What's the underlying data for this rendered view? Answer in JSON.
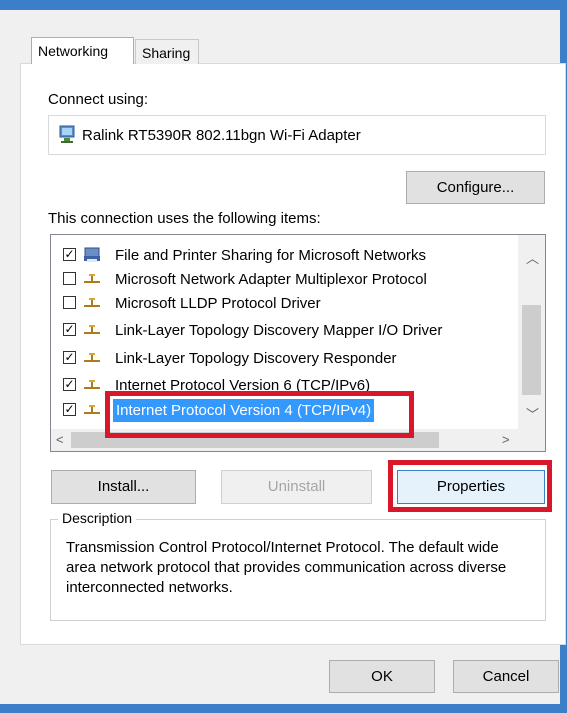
{
  "tabs": [
    {
      "label": "Networking",
      "active": true
    },
    {
      "label": "Sharing",
      "active": false
    }
  ],
  "connect_using_label": "Connect using:",
  "adapter_name": "Ralink RT5390R 802.11bgn Wi-Fi Adapter",
  "configure_button": "Configure...",
  "items_label": "This connection uses the following items:",
  "items": [
    {
      "label": "File and Printer Sharing for Microsoft Networks",
      "checked": true,
      "icon": "printer-share-icon"
    },
    {
      "label": "Microsoft Network Adapter Multiplexor Protocol",
      "checked": false,
      "icon": "protocol-icon"
    },
    {
      "label": "Microsoft LLDP Protocol Driver",
      "checked": false,
      "icon": "protocol-icon"
    },
    {
      "label": "Link-Layer Topology Discovery Mapper I/O Driver",
      "checked": true,
      "icon": "protocol-icon"
    },
    {
      "label": "Link-Layer Topology Discovery Responder",
      "checked": true,
      "icon": "protocol-icon"
    },
    {
      "label": "Internet Protocol Version 6 (TCP/IPv6)",
      "checked": true,
      "icon": "protocol-icon"
    },
    {
      "label": "Internet Protocol Version 4 (TCP/IPv4)",
      "checked": true,
      "icon": "protocol-icon",
      "selected": true
    }
  ],
  "buttons": {
    "install": "Install...",
    "uninstall": "Uninstall",
    "properties": "Properties",
    "ok": "OK",
    "cancel": "Cancel"
  },
  "description": {
    "title": "Description",
    "text": "Transmission Control Protocol/Internet Protocol. The default wide area network protocol that provides communication across diverse interconnected networks."
  },
  "colors": {
    "highlight": "#d8172a",
    "selection": "#3399ff",
    "window_border": "#3c7fc8"
  }
}
